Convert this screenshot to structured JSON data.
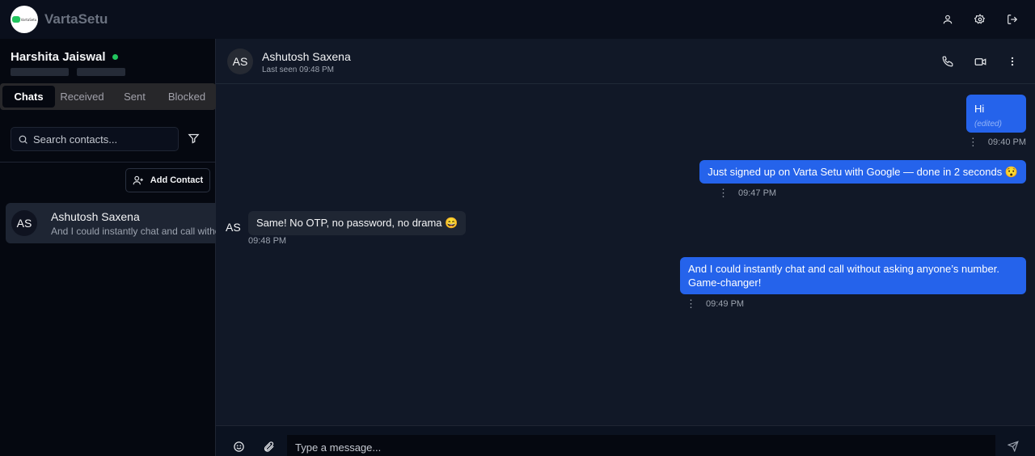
{
  "app": {
    "name": "VartaSetu",
    "logo_text": "VartaSetu"
  },
  "top_icons": [
    "user-icon",
    "settings-icon",
    "logout-icon"
  ],
  "user": {
    "name": "Harshita Jaiswal",
    "status": "online"
  },
  "tabs": [
    {
      "label": "Chats",
      "active": true
    },
    {
      "label": "Received",
      "active": false
    },
    {
      "label": "Sent",
      "active": false
    },
    {
      "label": "Blocked",
      "active": false
    }
  ],
  "search": {
    "placeholder": "Search contacts...",
    "value": ""
  },
  "add_contact_label": "Add Contact",
  "contacts": [
    {
      "initials": "AS",
      "name": "Ashutosh Saxena",
      "preview": "And I could instantly chat and call without asking anyone's number. Game-changer!"
    }
  ],
  "chat": {
    "initials": "AS",
    "name": "Ashutosh Saxena",
    "last_seen": "Last seen 09:48 PM",
    "header_icons": [
      "phone-icon",
      "video-icon",
      "more-vertical-icon"
    ],
    "messages": [
      {
        "direction": "out",
        "text": "Hi",
        "edited": "(edited)",
        "time": "09:40 PM"
      },
      {
        "direction": "out",
        "text": "Just signed up on Varta Setu with Google — done in 2 seconds 😯",
        "time": "09:47 PM"
      },
      {
        "direction": "in",
        "sender_initials": "AS",
        "text": "Same! No OTP, no password, no drama 😄",
        "time": "09:48 PM"
      },
      {
        "direction": "out",
        "text": "And I could instantly chat and call without asking anyone’s number. Game-changer!",
        "time": "09:49 PM"
      }
    ]
  },
  "composer": {
    "placeholder": "Type a message...",
    "value": ""
  },
  "colors": {
    "accent": "#2563eb",
    "online": "#22c55e",
    "background": "#111827",
    "sidebar": "#050810"
  }
}
